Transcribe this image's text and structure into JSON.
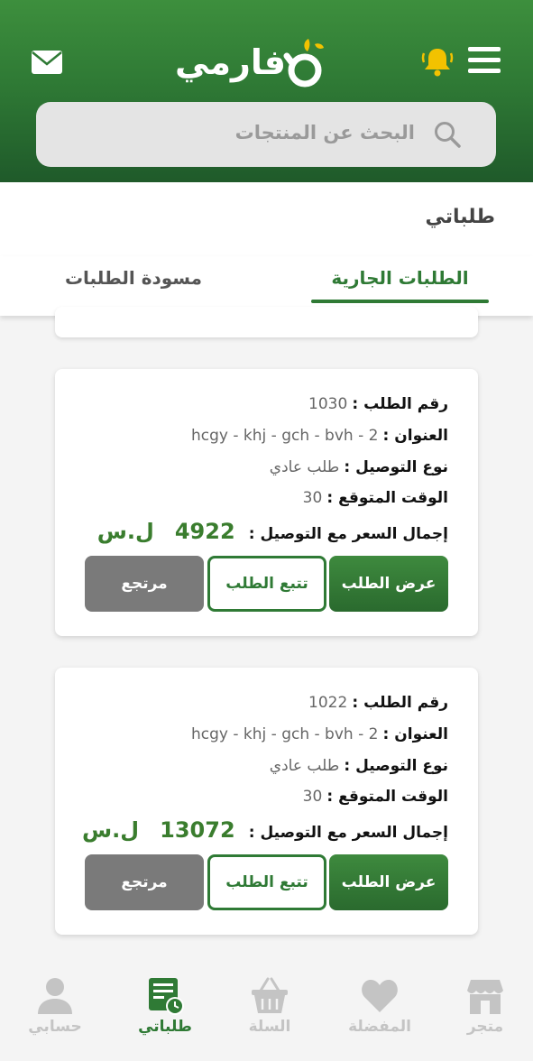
{
  "header": {
    "logo_text": "فارمي",
    "search_placeholder": "البحث عن المنتجات"
  },
  "page": {
    "title": "طلباتي"
  },
  "tabs": [
    {
      "label": "الطلبات الجارية",
      "active": true
    },
    {
      "label": "مسودة الطلبات",
      "active": false
    }
  ],
  "labels": {
    "order_number": "رقم الطلب :",
    "address": "العنوان :",
    "delivery_type": "نوع التوصيل :",
    "expected_time": "الوقت المتوقع :",
    "total": "إجمال السعر مع التوصيل :",
    "currency": "ل.س"
  },
  "orders": [
    {
      "number": "1030",
      "address": "hcgy - khj - gch - bvh - 2",
      "delivery_type": "طلب عادي",
      "expected_time": "30",
      "total": "4922",
      "buttons": {
        "view": "عرض الطلب",
        "track": "تتبع الطلب",
        "return": "مرتجع"
      }
    },
    {
      "number": "1022",
      "address": "hcgy - khj - gch - bvh - 2",
      "delivery_type": "طلب عادي",
      "expected_time": "30",
      "total": "13072",
      "buttons": {
        "view": "عرض الطلب",
        "track": "تتبع الطلب",
        "return": "مرتجع"
      }
    }
  ],
  "bottom_nav": [
    {
      "label": "متجر",
      "icon": "store-icon",
      "active": false
    },
    {
      "label": "المفضلة",
      "icon": "heart-icon",
      "active": false
    },
    {
      "label": "السلة",
      "icon": "basket-icon",
      "active": false
    },
    {
      "label": "طلباتي",
      "icon": "orders-icon",
      "active": true
    },
    {
      "label": "حسابي",
      "icon": "user-icon",
      "active": false
    }
  ],
  "colors": {
    "brand_green": "#2f7a35",
    "accent_yellow": "#f2c200",
    "inactive_gray": "#c4c4c4"
  }
}
